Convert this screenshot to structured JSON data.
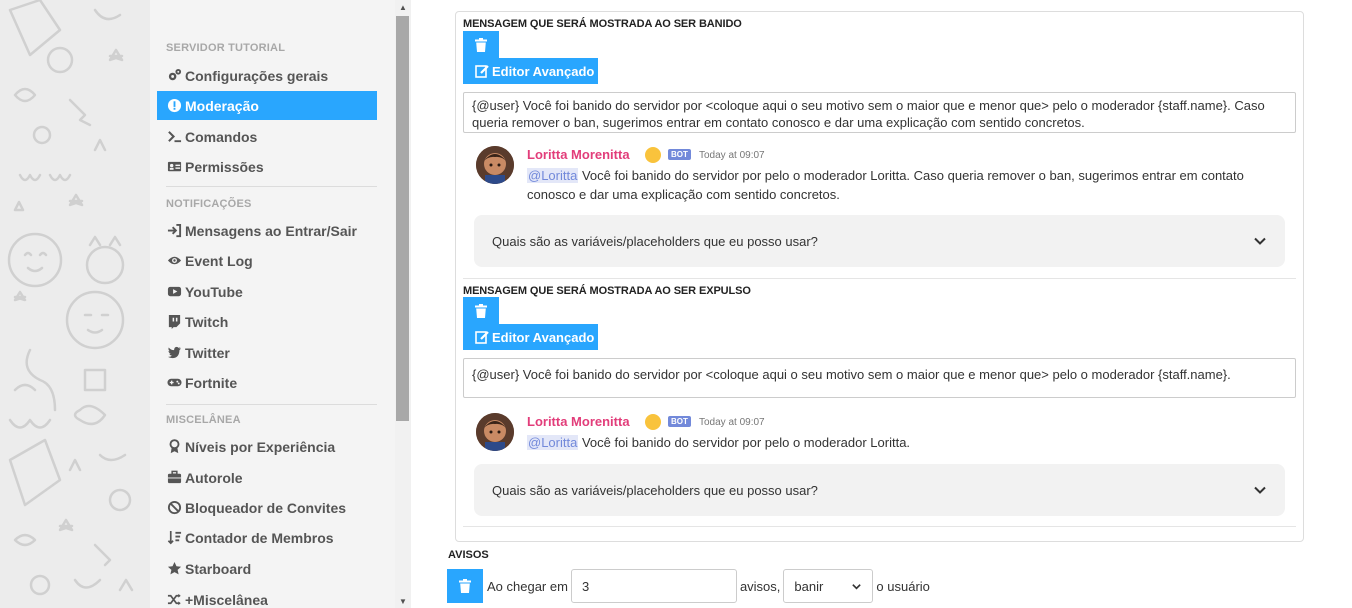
{
  "sidebar": {
    "sections": [
      {
        "title": "SERVIDOR TUTORIAL"
      },
      {
        "title": "NOTIFICAÇÕES"
      },
      {
        "title": "MISCELÂNEA"
      }
    ],
    "items": [
      {
        "label": "Configurações gerais",
        "icon": "gears-icon"
      },
      {
        "label": "Moderação",
        "icon": "exclamation-circle-icon",
        "active": true
      },
      {
        "label": "Comandos",
        "icon": "terminal-icon"
      },
      {
        "label": "Permissões",
        "icon": "id-card-icon"
      },
      {
        "label": "Mensagens ao Entrar/Sair",
        "icon": "sign-in-icon"
      },
      {
        "label": "Event Log",
        "icon": "eye-icon"
      },
      {
        "label": "YouTube",
        "icon": "youtube-icon"
      },
      {
        "label": "Twitch",
        "icon": "twitch-icon"
      },
      {
        "label": "Twitter",
        "icon": "twitter-icon"
      },
      {
        "label": "Fortnite",
        "icon": "gamepad-icon"
      },
      {
        "label": "Níveis por Experiência",
        "icon": "ribbon-icon"
      },
      {
        "label": "Autorole",
        "icon": "briefcase-icon"
      },
      {
        "label": "Bloqueador de Convites",
        "icon": "ban-icon"
      },
      {
        "label": "Contador de Membros",
        "icon": "sort-numeric-icon"
      },
      {
        "label": "Starboard",
        "icon": "star-icon"
      },
      {
        "label": "+Miscelânea",
        "icon": "random-icon"
      }
    ]
  },
  "ban_message": {
    "label": "MENSAGEM QUE SERÁ MOSTRADA AO SER BANIDO",
    "editor_label": "Editor Avançado",
    "text": "{@user} Você foi banido do servidor por <coloque aqui o seu motivo sem o maior que e menor que> pelo o moderador {staff.name}. Caso queria remover o ban, sugerimos entrar em contato conosco e dar uma explicação com sentido concretos.",
    "preview": {
      "author": "Loritta Morenitta",
      "bot_tag": "BOT",
      "timestamp": "Today at 09:07",
      "mention": "@Loritta",
      "text": " Você foi banido do servidor por  pelo o moderador Loritta. Caso queria remover o ban, sugerimos entrar em contato conosco e dar uma explicação com sentido concretos."
    },
    "faq": "Quais são as variáveis/placeholders que eu posso usar?"
  },
  "kick_message": {
    "label": "MENSAGEM QUE SERÁ MOSTRADA AO SER EXPULSO",
    "editor_label": "Editor Avançado",
    "text": "{@user} Você foi banido do servidor por <coloque aqui o seu motivo sem o maior que e menor que> pelo o moderador {staff.name}.",
    "preview": {
      "author": "Loritta Morenitta",
      "bot_tag": "BOT",
      "timestamp": "Today at 09:07",
      "mention": "@Loritta",
      "text": " Você foi banido do servidor por  pelo o moderador Loritta."
    },
    "faq": "Quais são as variáveis/placeholders que eu posso usar?"
  },
  "warnings": {
    "label": "AVISOS",
    "prefix": "Ao chegar em",
    "count": "3",
    "middle": "avisos,",
    "action": "banir",
    "suffix": "o usuário"
  },
  "colors": {
    "accent": "#29a6fe",
    "author": "#e23d7a",
    "bot_tag": "#7289da"
  }
}
